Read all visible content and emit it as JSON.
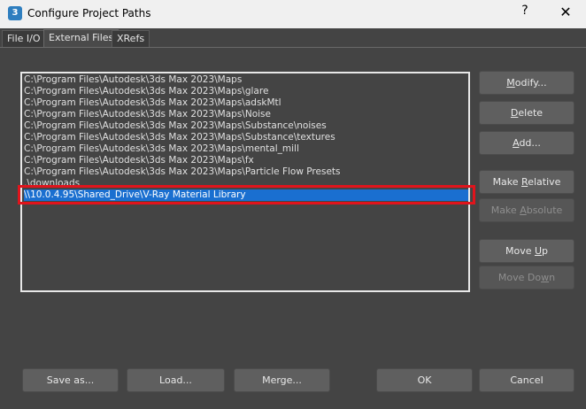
{
  "window": {
    "title": "Configure Project Paths",
    "app_icon_text": "3",
    "help": "?",
    "close": "✕"
  },
  "tabs": [
    {
      "label": "File I/O",
      "active": false
    },
    {
      "label": "External Files",
      "active": true
    },
    {
      "label": "XRefs",
      "active": false
    }
  ],
  "paths": [
    "C:\\Program Files\\Autodesk\\3ds Max 2023\\Maps",
    "C:\\Program Files\\Autodesk\\3ds Max 2023\\Maps\\glare",
    "C:\\Program Files\\Autodesk\\3ds Max 2023\\Maps\\adskMtl",
    "C:\\Program Files\\Autodesk\\3ds Max 2023\\Maps\\Noise",
    "C:\\Program Files\\Autodesk\\3ds Max 2023\\Maps\\Substance\\noises",
    "C:\\Program Files\\Autodesk\\3ds Max 2023\\Maps\\Substance\\textures",
    "C:\\Program Files\\Autodesk\\3ds Max 2023\\Maps\\mental_mill",
    "C:\\Program Files\\Autodesk\\3ds Max 2023\\Maps\\fx",
    "C:\\Program Files\\Autodesk\\3ds Max 2023\\Maps\\Particle Flow Presets",
    ".\\downloads",
    "\\\\10.0.4.95\\Shared_Drive\\V-Ray Material Library"
  ],
  "selected_index": 10,
  "side_buttons": {
    "modify": {
      "pre": "",
      "u": "M",
      "post": "odify..."
    },
    "delete": {
      "pre": "",
      "u": "D",
      "post": "elete"
    },
    "add": {
      "pre": "",
      "u": "A",
      "post": "dd..."
    },
    "make_relative": {
      "pre": "Make ",
      "u": "R",
      "post": "elative"
    },
    "make_absolute": {
      "pre": "Make ",
      "u": "A",
      "post": "bsolute"
    },
    "move_up": {
      "pre": "Move ",
      "u": "U",
      "post": "p"
    },
    "move_down": {
      "pre": "Move Do",
      "u": "w",
      "post": "n"
    }
  },
  "bottom_buttons": {
    "save_as": "Save as...",
    "load": "Load...",
    "merge": "Merge...",
    "ok": "OK",
    "cancel": "Cancel"
  }
}
